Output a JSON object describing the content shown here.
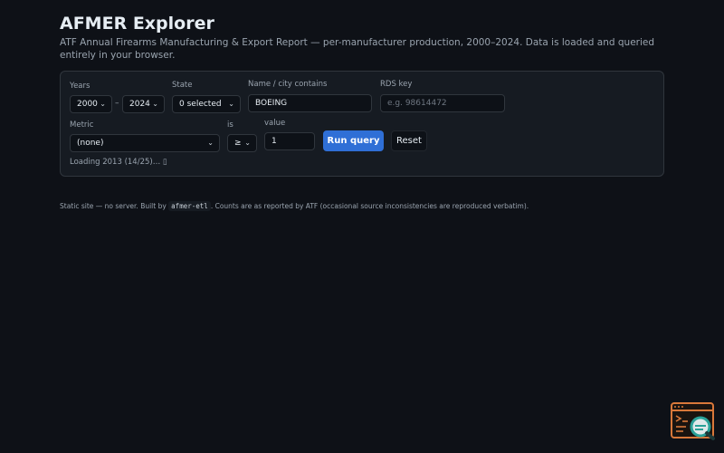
{
  "header": {
    "title": "AFMER Explorer",
    "subtitle": "ATF Annual Firearms Manufacturing & Export Report — per-manufacturer production, 2000–2024. Data is loaded and queried entirely in your browser."
  },
  "filters": {
    "years_label": "Years",
    "year_from": "2000",
    "year_sep": "–",
    "year_to": "2024",
    "state_label": "State",
    "state_value": "0 selected",
    "name_label": "Name / city contains",
    "name_value": "BOEING",
    "rds_label": "RDS key",
    "rds_placeholder": "e.g. 98614472",
    "metric_label": "Metric",
    "metric_value": "(none)",
    "op_label": "is",
    "op_value": "≥",
    "value_label": "value",
    "value_value": "1"
  },
  "actions": {
    "run_label": "Run query",
    "reset_label": "Reset"
  },
  "status": {
    "text": "Loading 2013 (14/25)… ▯"
  },
  "footer": {
    "before": "Static site — no server. Built by ",
    "code": "afmer-etl",
    "after": ". Counts are as reported by ATF (occasional source inconsistencies are reproduced verbatim)."
  },
  "colors": {
    "background": "#0e1117",
    "panel": "#161b22",
    "accent": "#2f6fd6",
    "widget_orange": "#d9783a",
    "widget_teal": "#2aa198"
  },
  "icons": {
    "chevron": "chevron-down-icon",
    "widget": "terminal-search-icon"
  }
}
